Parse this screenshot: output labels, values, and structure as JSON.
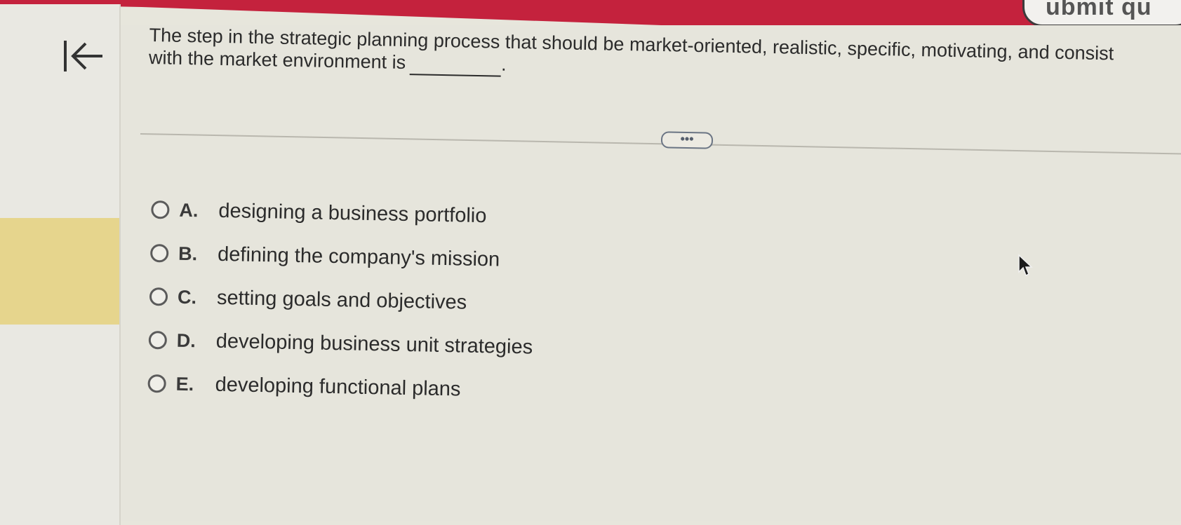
{
  "header": {
    "badge_text": "ubmit qu"
  },
  "navigation": {
    "back_icon": "arrow-left-to-bar-icon"
  },
  "question": {
    "line1": "The step in the strategic planning process that should be market-oriented, realistic, specific, motivating, and consist",
    "line2": "with the market environment is",
    "after_blank": "."
  },
  "more_button": {
    "label": "•••"
  },
  "options": [
    {
      "letter": "A.",
      "text": "designing a business portfolio"
    },
    {
      "letter": "B.",
      "text": "defining the company's mission"
    },
    {
      "letter": "C.",
      "text": "setting goals and objectives"
    },
    {
      "letter": "D.",
      "text": "developing business unit strategies"
    },
    {
      "letter": "E.",
      "text": "developing functional plans"
    }
  ],
  "colors": {
    "banner": "#c4223d",
    "sidebar_highlight": "#e6d58d",
    "background": "#e6e5dc"
  }
}
